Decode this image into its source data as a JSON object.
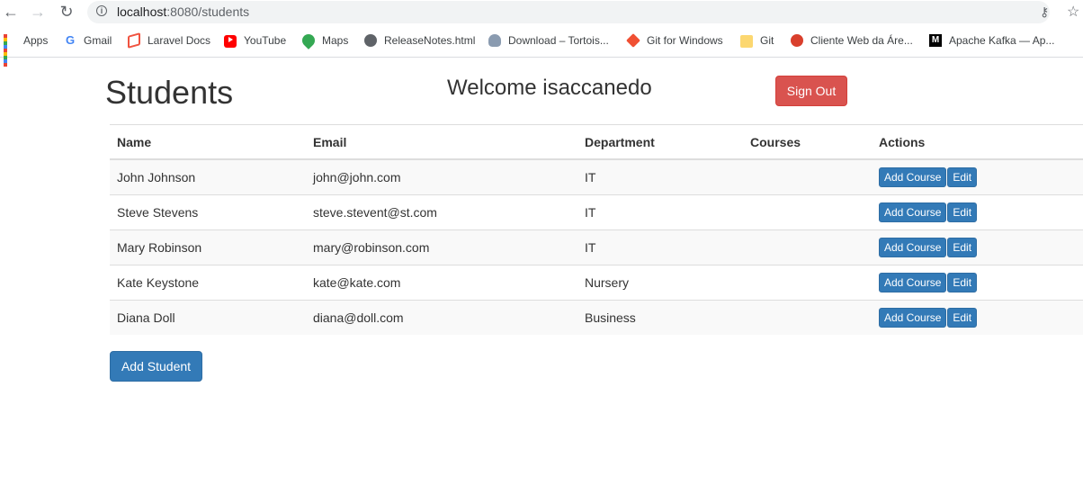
{
  "browser": {
    "url_host": "localhost",
    "url_rest": ":8080/students",
    "bookmarks": [
      {
        "label": "Apps",
        "icon": "apps-grid-icon"
      },
      {
        "label": "Gmail",
        "icon": "google-g-icon"
      },
      {
        "label": "Laravel Docs",
        "icon": "laravel-icon"
      },
      {
        "label": "YouTube",
        "icon": "youtube-icon"
      },
      {
        "label": "Maps",
        "icon": "maps-pin-icon"
      },
      {
        "label": "ReleaseNotes.html",
        "icon": "globe-icon"
      },
      {
        "label": "Download – Tortois...",
        "icon": "tortoise-icon"
      },
      {
        "label": "Git for Windows",
        "icon": "git-icon"
      },
      {
        "label": "Git",
        "icon": "folder-icon"
      },
      {
        "label": "Cliente Web da Áre...",
        "icon": "cliente-icon"
      },
      {
        "label": "Apache Kafka — Ap...",
        "icon": "medium-icon"
      }
    ]
  },
  "header": {
    "title": "Students",
    "welcome": "Welcome isaccanedo",
    "signout_label": "Sign Out"
  },
  "table": {
    "columns": [
      "Name",
      "Email",
      "Department",
      "Courses",
      "Actions"
    ],
    "rows": [
      {
        "name": "John Johnson",
        "email": "john@john.com",
        "department": "IT",
        "courses": ""
      },
      {
        "name": "Steve Stevens",
        "email": "steve.stevent@st.com",
        "department": "IT",
        "courses": ""
      },
      {
        "name": "Mary Robinson",
        "email": "mary@robinson.com",
        "department": "IT",
        "courses": ""
      },
      {
        "name": "Kate Keystone",
        "email": "kate@kate.com",
        "department": "Nursery",
        "courses": ""
      },
      {
        "name": "Diana Doll",
        "email": "diana@doll.com",
        "department": "Business",
        "courses": ""
      }
    ],
    "add_course_label": "Add Course",
    "edit_label": "Edit"
  },
  "add_student_label": "Add Student",
  "colors": {
    "primary": "#337ab7",
    "danger": "#d9534f"
  }
}
